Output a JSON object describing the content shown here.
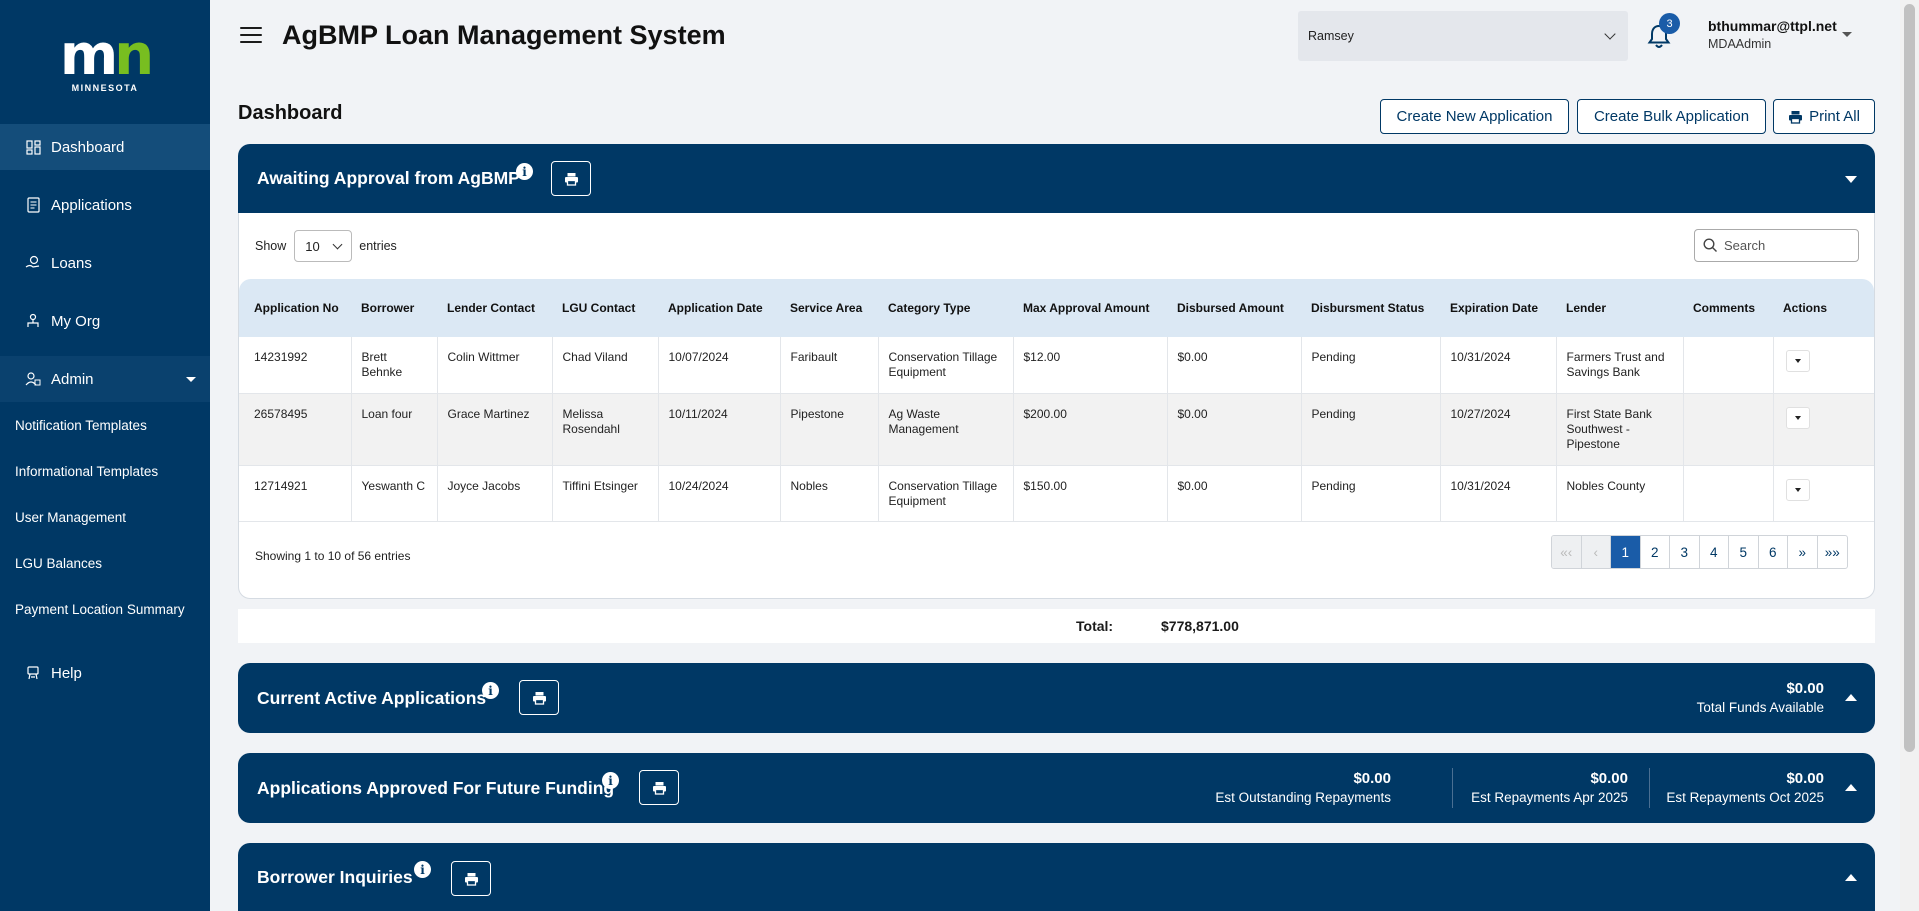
{
  "sidebar": {
    "logo_text": "MINNESOTA",
    "items": [
      {
        "label": "Dashboard"
      },
      {
        "label": "Applications"
      },
      {
        "label": "Loans"
      },
      {
        "label": "My Org"
      }
    ],
    "admin_label": "Admin",
    "admin_items": [
      {
        "label": "Notification Templates"
      },
      {
        "label": "Informational Templates"
      },
      {
        "label": "User Management"
      },
      {
        "label": "LGU Balances"
      },
      {
        "label": "Payment Location Summary"
      }
    ],
    "help_label": "Help"
  },
  "header": {
    "title": "AgBMP Loan Management System",
    "county": "Ramsey",
    "notification_count": "3",
    "user_email": "bthummar@ttpl.net",
    "user_role": "MDAAdmin"
  },
  "main": {
    "page_title": "Dashboard",
    "buttons": {
      "create_new": "Create New Application",
      "create_bulk": "Create Bulk Application",
      "print_all": "Print All"
    },
    "awaiting": {
      "title": "Awaiting Approval from AgBMP",
      "show_label": "Show",
      "entries_label": "entries",
      "page_length": "10",
      "search_placeholder": "Search",
      "columns": [
        "Application No",
        "Borrower",
        "Lender Contact",
        "LGU Contact",
        "Application Date",
        "Service Area",
        "Category Type",
        "Max Approval Amount",
        "Disbursed Amount",
        "Disbursment Status",
        "Expiration Date",
        "Lender",
        "Comments",
        "Actions"
      ],
      "rows": [
        [
          "14231992",
          "Brett Behnke",
          "Colin Wittmer",
          "Chad Viland",
          "10/07/2024",
          "Faribault",
          "Conservation Tillage Equipment",
          "$12.00",
          "$0.00",
          "Pending",
          "10/31/2024",
          "Farmers Trust and Savings Bank",
          ""
        ],
        [
          "26578495",
          "Loan four",
          "Grace Martinez",
          "Melissa Rosendahl",
          "10/11/2024",
          "Pipestone",
          "Ag Waste Management",
          "$200.00",
          "$0.00",
          "Pending",
          "10/27/2024",
          "First State Bank Southwest - Pipestone",
          ""
        ],
        [
          "12714921",
          "Yeswanth C",
          "Joyce Jacobs",
          "Tiffini Etsinger",
          "10/24/2024",
          "Nobles",
          "Conservation Tillage Equipment",
          "$150.00",
          "$0.00",
          "Pending",
          "10/31/2024",
          "Nobles County",
          ""
        ]
      ],
      "info": "Showing 1 to 10 of 56 entries",
      "pagination": [
        "«‹",
        "‹",
        "1",
        "2",
        "3",
        "4",
        "5",
        "6",
        "»",
        "»»"
      ],
      "current_page": "1",
      "total_label": "Total:",
      "total_value": "$778,871.00"
    },
    "current_active": {
      "title": "Current Active Applications",
      "stat_value": "$0.00",
      "stat_label": "Total Funds Available"
    },
    "future_funding": {
      "title": "Applications Approved For Future Funding",
      "stats": [
        {
          "value": "$0.00",
          "label": "Est Outstanding Repayments"
        },
        {
          "value": "$0.00",
          "label": "Est Repayments Apr 2025"
        },
        {
          "value": "$0.00",
          "label": "Est Repayments Oct 2025"
        }
      ]
    },
    "inquiries": {
      "title": "Borrower Inquiries"
    }
  },
  "colors": {
    "primary": "#003865",
    "accent_green": "#78be20",
    "link_blue": "#1a5ca8",
    "table_header": "#dbe8f4"
  },
  "icons": [
    "dashboard-icon",
    "applications-icon",
    "loans-icon",
    "org-icon",
    "admin-icon",
    "help-icon",
    "bell-icon",
    "print-icon",
    "info-icon",
    "search-icon"
  ]
}
